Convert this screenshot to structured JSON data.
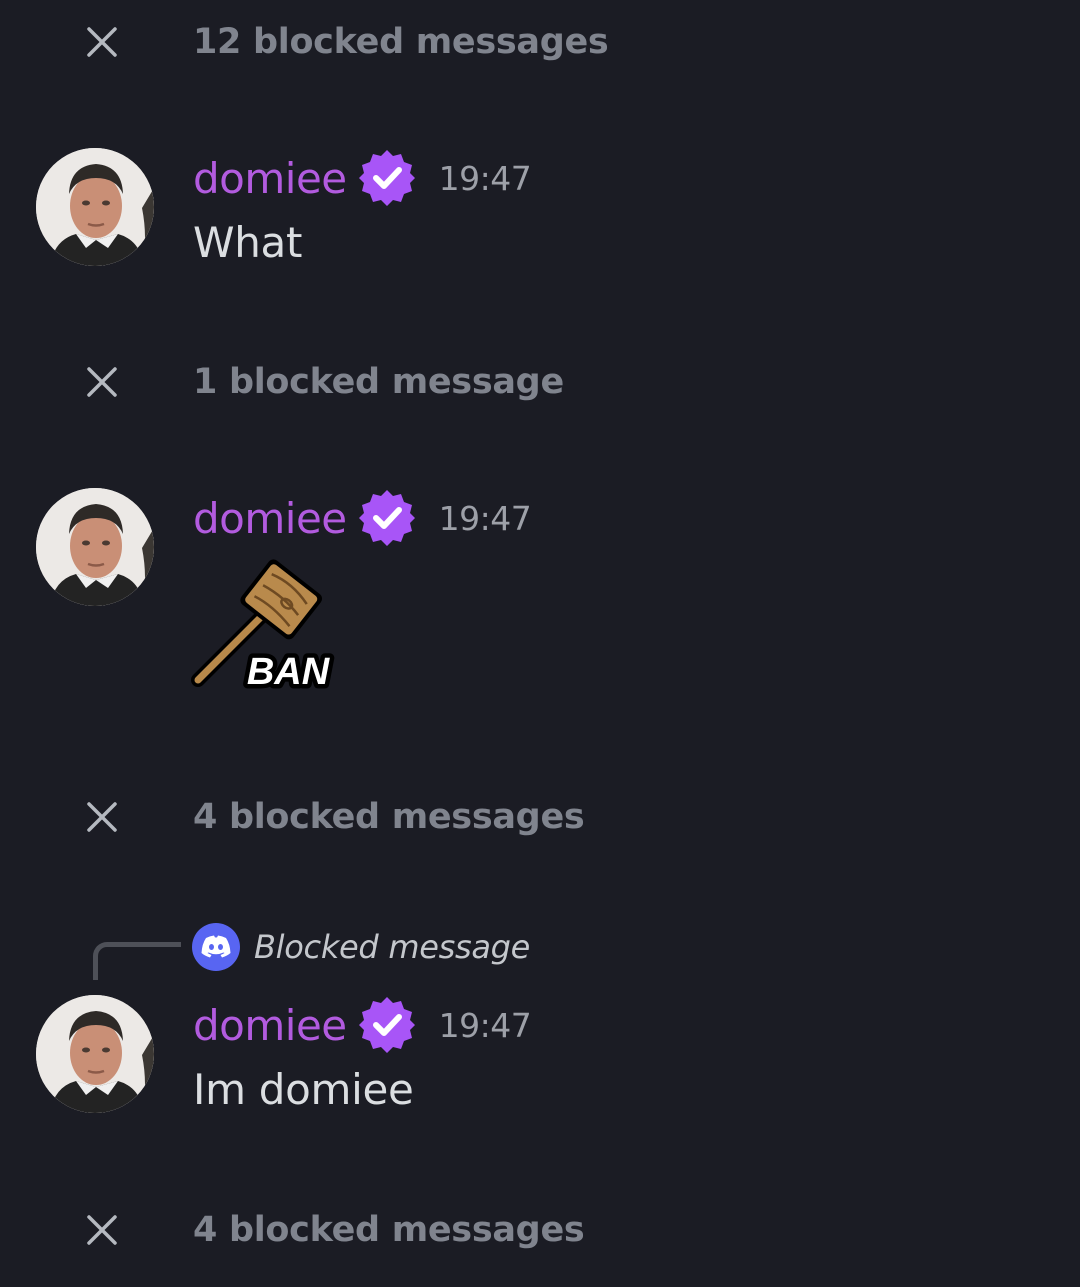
{
  "chat": {
    "blocked_1": {
      "label": "12 blocked messages",
      "icon": "close-icon"
    },
    "message_1": {
      "username": "domiee",
      "verified_icon": "verified-badge-icon",
      "timestamp": "19:47",
      "text": "What"
    },
    "blocked_2": {
      "label": "1 blocked message",
      "icon": "close-icon"
    },
    "message_2": {
      "username": "domiee",
      "verified_icon": "verified-badge-icon",
      "timestamp": "19:47",
      "sticker": {
        "name": "ban-hammer-sticker",
        "text": "BAN"
      }
    },
    "blocked_3": {
      "label": "4 blocked messages",
      "icon": "close-icon"
    },
    "message_3": {
      "reply": {
        "icon": "discord-icon",
        "text": "Blocked message"
      },
      "username": "domiee",
      "verified_icon": "verified-badge-icon",
      "timestamp": "19:47",
      "text": "Im domiee"
    },
    "blocked_4": {
      "label": "4 blocked messages",
      "icon": "close-icon"
    }
  },
  "colors": {
    "background": "#1b1c24",
    "username": "#b25bdf",
    "verified_badge": "#a855f7",
    "blocked_text": "#80848e",
    "message_text": "#dbdee1",
    "timestamp": "#9da0a8",
    "discord_blurple": "#5865f2"
  }
}
